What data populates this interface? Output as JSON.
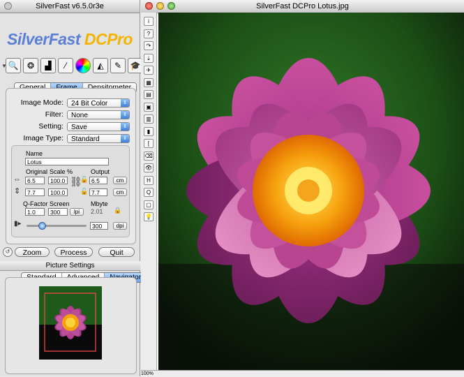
{
  "left_window": {
    "title": "SilverFast v6.5.0r3e",
    "logo_main": "SilverFast",
    "logo_sub": "DCPro",
    "toolbar_icons": [
      "zoom-icon",
      "histogram-icon",
      "levels-icon",
      "gradation-icon",
      "color-balance-icon",
      "selective-color-icon",
      "sharpen-icon",
      "wizard-icon"
    ],
    "tabs": [
      "General",
      "Frame",
      "Densitometer"
    ],
    "selected_tab": "Frame",
    "rows": [
      {
        "label": "Image Mode:",
        "value": "24 Bit Color"
      },
      {
        "label": "Filter:",
        "value": "None"
      },
      {
        "label": "Setting:",
        "value": "Save"
      },
      {
        "label": "Image Type:",
        "value": "Standard"
      }
    ],
    "name_label": "Name",
    "name_value": "Lotus",
    "col_original": "Original",
    "col_scale": "Scale %",
    "col_output": "Output",
    "width_original": "6.5",
    "width_scale": "100.0",
    "width_output": "6.5",
    "height_original": "7.7",
    "height_scale": "100.0",
    "height_output": "7.7",
    "unit_cm_1": "cm",
    "unit_cm_2": "cm",
    "qfactor_label": "Q-Factor",
    "screen_label": "Screen",
    "mbyte_label": "Mbyte",
    "qfactor_value": "1.0",
    "screen_value": "300",
    "screen_unit": "lpi",
    "mbyte_value": "2.01",
    "res_value": "300",
    "res_unit": "dpi",
    "slider_fraction": 0.27,
    "buttons": {
      "zoom": "Zoom",
      "process": "Process",
      "quit": "Quit"
    },
    "picture_settings_title": "Picture Settings",
    "picture_tabs": [
      "Standard",
      "Advanced",
      "Navigator"
    ],
    "selected_picture_tab": "Navigator"
  },
  "right_window": {
    "title": "SilverFast DCPro Lotus.jpg",
    "zoom_level": "100%",
    "tool_icons": [
      "info-icon",
      "help-icon",
      "redo-icon",
      "align-icon",
      "plane-icon",
      "pattern-icon",
      "grid-icon",
      "frame-icon",
      "multi-frame-icon",
      "ruler-icon",
      "bracket-icon",
      "erase-icon",
      "eye-icon",
      "hdr-icon",
      "search-icon",
      "print-icon",
      "bulb-icon"
    ],
    "tool_glyphs": [
      "i",
      "?",
      "↷",
      "⇣",
      "✈",
      "▦",
      "▤",
      "▣",
      "▥",
      "▮",
      "[",
      "⌫",
      "👁",
      "H",
      "Q",
      "▢",
      "💡"
    ]
  },
  "colors": {
    "accent": "#6aa4ef",
    "logo_blue": "#5a7fd4",
    "logo_gold": "#f2b400",
    "nav_frame": "#ff4a4a"
  }
}
